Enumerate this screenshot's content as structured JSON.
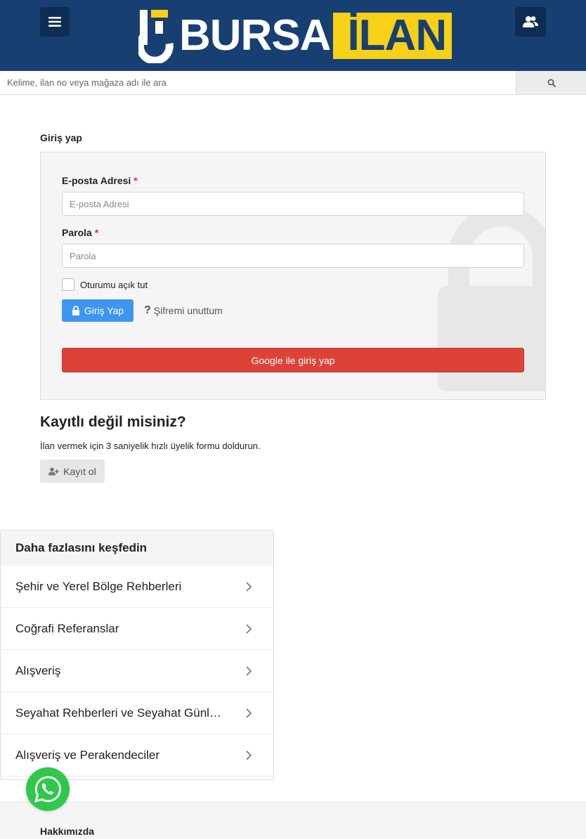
{
  "header": {
    "logo_text_white": "BURSA",
    "logo_text_highlight": "İLAN",
    "colors": {
      "background": "#173f72",
      "button": "#0e2d55",
      "logo_yellow": "#f7d117"
    },
    "icons": {
      "menu": "hamburger-icon",
      "user": "users-icon"
    }
  },
  "search": {
    "placeholder": "Kelime, ilan no veya mağaza adı ile ara",
    "icon": "search-icon"
  },
  "login": {
    "title": "Giriş yap",
    "email_label": "E-posta Adresi",
    "email_placeholder": "E-posta Adresi",
    "password_label": "Parola",
    "password_placeholder": "Parola",
    "required_mark": "*",
    "remember_label": "Oturumu açık tut",
    "submit_label": "Giriş Yap",
    "forgot_label": "Şifremi unuttum",
    "google_label": "Google ile giriş yap",
    "colors": {
      "submit": "#3d97f0",
      "google": "#dc4236"
    }
  },
  "register": {
    "heading": "Kayıtlı değil misiniz?",
    "description": "İlan vermek için 3 saniyelik hızlı üyelik formu doldurun.",
    "button_label": "Kayıt ol"
  },
  "discover": {
    "title": "Daha fazlasını keşfedin",
    "items": [
      {
        "label": "Şehir ve Yerel Bölge Rehberleri"
      },
      {
        "label": "Coğrafi Referanslar"
      },
      {
        "label": "Alışveriş"
      },
      {
        "label": "Seyahat Rehberleri ve Seyahat Günlükleri"
      },
      {
        "label": "Alışveriş ve Perakendeciler"
      }
    ]
  },
  "footer": {
    "title": "Hakkımızda"
  }
}
